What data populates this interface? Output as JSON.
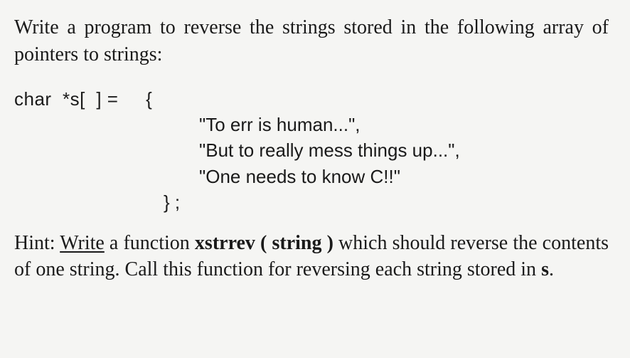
{
  "intro": "Write a program to reverse the strings stored in the following array of pointers to strings:",
  "code": {
    "decl": "char  *s[  ] =     {",
    "strings": [
      "\"To err is human...\",",
      "\"But to really mess things up...\",",
      "\"One needs to know C!!\""
    ],
    "close": "} ;"
  },
  "hint": {
    "label": "Hint: ",
    "text1_underlined": "Write",
    "text2": " a function ",
    "func": "xstrrev ( string )",
    "text3": " which should reverse the contents of one string. Call this function for reversing each string stored in ",
    "varname": "s",
    "text4": "."
  }
}
